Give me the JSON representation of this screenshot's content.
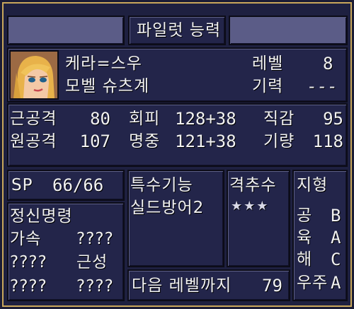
{
  "header": {
    "title": "파일럿 능력"
  },
  "pilot": {
    "name": "케라=스우",
    "unit": "모벨 슈츠계",
    "level_label": "레벨",
    "level_value": "8",
    "spirit_label": "기력",
    "spirit_value": "---"
  },
  "stats": {
    "melee_label": "근공격",
    "melee_value": "80",
    "evade_label": "회피",
    "evade_value": "128+38",
    "intuition_label": "직감",
    "intuition_value": "95",
    "ranged_label": "원공격",
    "ranged_value": "107",
    "accuracy_label": "명중",
    "accuracy_value": "121+38",
    "skill_label": "기량",
    "skill_value": "118"
  },
  "sp": {
    "label": "SP",
    "value": "66/66"
  },
  "spirit_commands": {
    "title": "정신명령",
    "items": [
      [
        "가속",
        "????"
      ],
      [
        "????",
        "근성"
      ],
      [
        "????",
        "????"
      ]
    ]
  },
  "special_skills": {
    "title": "특수기능",
    "items": [
      "실드방어2"
    ]
  },
  "kill_count": {
    "title": "격추수",
    "value": "★★★"
  },
  "next_level": {
    "label": "다음 레벨까지",
    "value": "79"
  },
  "terrain": {
    "title": "지형",
    "rows": [
      {
        "label": "공",
        "grade": "B"
      },
      {
        "label": "육",
        "grade": "A"
      },
      {
        "label": "해",
        "grade": "C"
      },
      {
        "label": "우주",
        "grade": "A"
      }
    ]
  }
}
